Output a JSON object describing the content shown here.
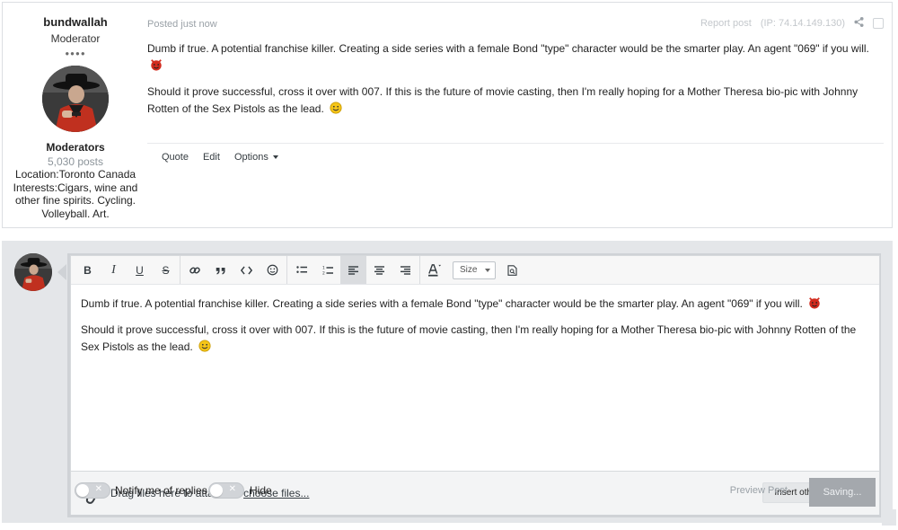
{
  "post": {
    "author": {
      "name": "bundwallah",
      "role": "Moderator",
      "pips": "●●●●",
      "group": "Moderators",
      "post_count": "5,030 posts",
      "location": "Location:Toronto Canada",
      "interests": "Interests:Cigars, wine and other fine spirits. Cycling. Volleyball. Art."
    },
    "date": "Posted just now",
    "report_label": "Report post",
    "ip_label": "(IP: 74.14.149.130)",
    "body": {
      "p1": "Dumb if true.  A potential franchise killer.  Creating a side series with a female Bond \"type\" character would be the smarter play. An agent \"069\" if you will.",
      "p2": "Should it prove successful, cross it over with 007.  If this is the future of movie casting, then I'm really hoping for a  Mother Theresa bio-pic with Johnny Rotten of the Sex Pistols as the lead."
    },
    "controls": {
      "quote": "Quote",
      "edit": "Edit",
      "options": "Options"
    }
  },
  "editor": {
    "toolbar": {
      "bold": "B",
      "italic": "I",
      "underline": "U",
      "strike": "S",
      "size": "Size"
    },
    "content": {
      "p1": "Dumb if true.  A potential franchise killer.  Creating a side series with a female Bond \"type\" character would be the smarter play. An agent \"069\" if you will.",
      "p2": "Should it prove successful, cross it over with 007.  If this is the future of movie casting, then I'm really hoping for a  Mother Theresa bio-pic with Johnny Rotten of the Sex Pistols as the lead."
    },
    "attach": {
      "text": "Drag files here to attach, or",
      "link": "choose files..."
    },
    "insert_media": "Insert other media"
  },
  "footer": {
    "notify_label": "Notify me of replies",
    "hide_label": "Hide",
    "preview": "Preview Post",
    "saving": "Saving..."
  },
  "colors": {
    "accent_grey": "#a4a8ad",
    "reply_bg": "#e4e6e9",
    "devil_emoji": "#d22b1e",
    "smile_emoji": "#f5c518"
  }
}
